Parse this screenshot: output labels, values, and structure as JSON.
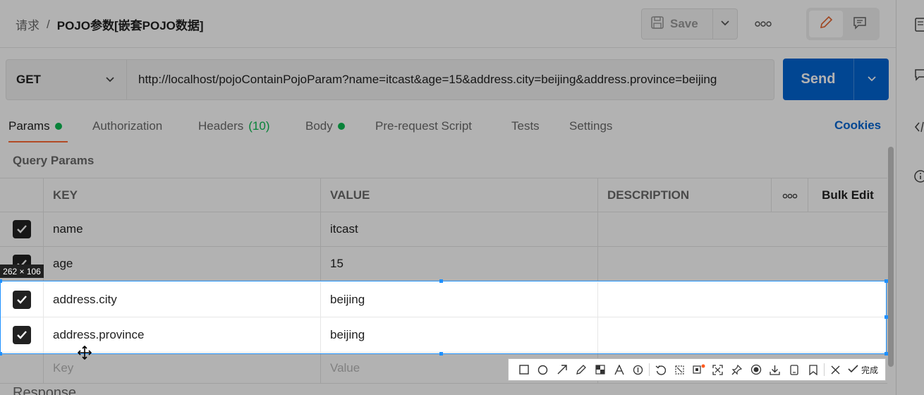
{
  "breadcrumb": {
    "parent": "请求",
    "separator": "/",
    "current": "POJO参数[嵌套POJO数据]"
  },
  "toolbar": {
    "save_label": "Save",
    "more_label": "ooo"
  },
  "request": {
    "method": "GET",
    "url": "http://localhost/pojoContainPojoParam?name=itcast&age=15&address.city=beijing&address.province=beijing",
    "send_label": "Send"
  },
  "tabs": [
    {
      "label": "Params",
      "dot": true
    },
    {
      "label": "Authorization"
    },
    {
      "label": "Headers",
      "count": "(10)"
    },
    {
      "label": "Body",
      "dot": true
    },
    {
      "label": "Pre-request Script"
    },
    {
      "label": "Tests"
    },
    {
      "label": "Settings"
    }
  ],
  "cookies_label": "Cookies",
  "query_params": {
    "title": "Query Params",
    "headers": {
      "key": "KEY",
      "value": "VALUE",
      "description": "DESCRIPTION",
      "more": "ooo",
      "bulk_edit": "Bulk Edit"
    },
    "rows": [
      {
        "key": "name",
        "value": "itcast",
        "checked": true
      },
      {
        "key": "age",
        "value": "15",
        "checked": true
      },
      {
        "key": "address.city",
        "value": "beijing",
        "checked": true
      },
      {
        "key": "address.province",
        "value": "beijing",
        "checked": true
      }
    ],
    "placeholder": {
      "key": "Key",
      "value": "Value"
    }
  },
  "capture": {
    "size_label": "262 × 106",
    "done_label": "完成"
  },
  "response_label": "Response",
  "colors": {
    "accent": "#ff6c37",
    "send": "#0265d2",
    "dot": "#0cbb52",
    "selection": "#1e90ff"
  }
}
